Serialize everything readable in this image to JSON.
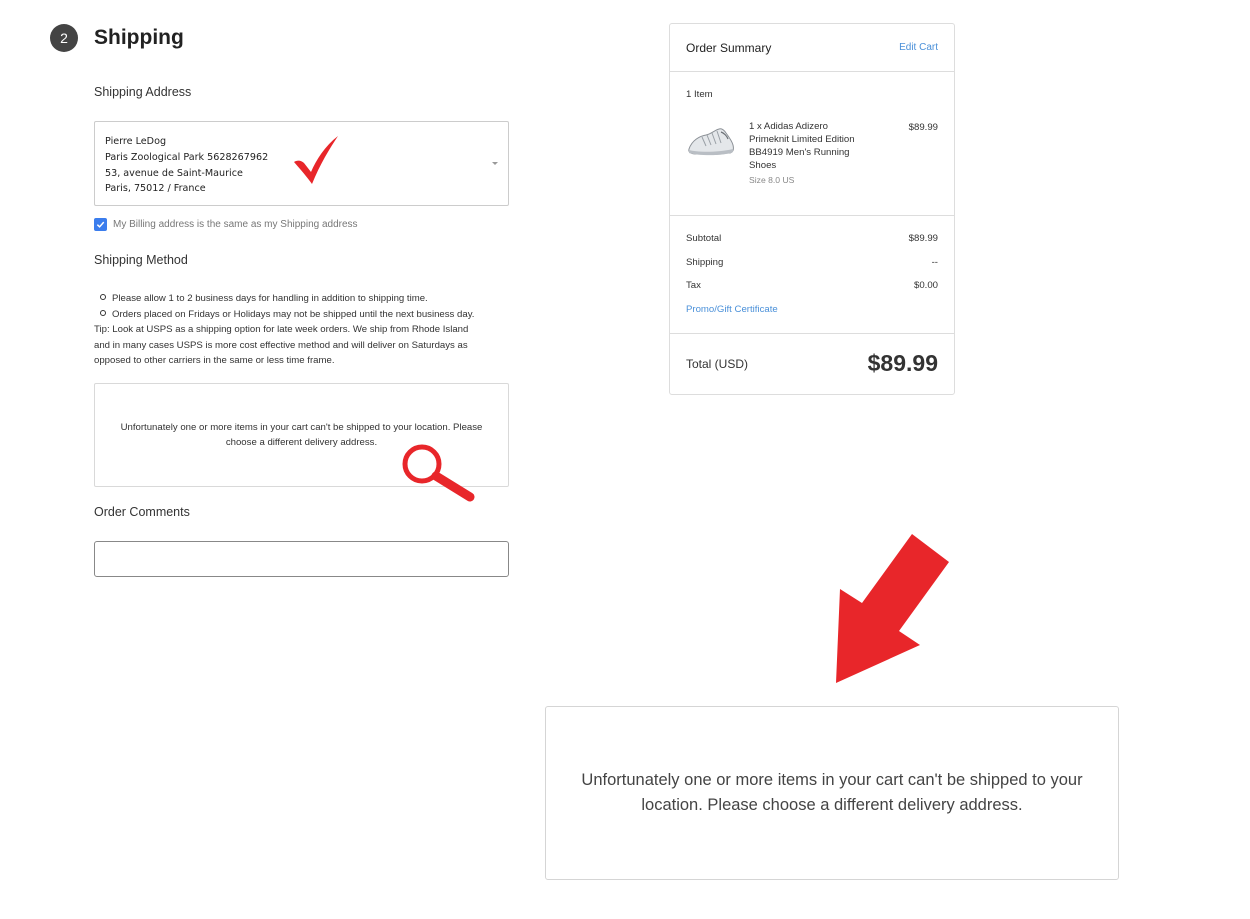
{
  "shipping": {
    "step_number": "2",
    "title": "Shipping",
    "address_label": "Shipping Address",
    "address_lines": [
      "Pierre LeDog",
      "Paris Zoological Park 5628267962",
      "53, avenue de Saint-Maurice",
      "Paris, 75012 / France"
    ],
    "billing_same_label": "My Billing address is the same as my Shipping address",
    "billing_same_checked": true,
    "method_label": "Shipping Method",
    "method_notes": [
      "Please allow 1 to 2 business days for handling in addition to shipping time.",
      "Orders placed on Fridays or Holidays may not be shipped until the next business day."
    ],
    "method_tip_lines": [
      "Tip: Look at USPS as a shipping option for late week orders. We ship from Rhode Island",
      "and in many cases USPS is more cost effective method and will deliver on Saturdays as",
      "opposed to other carriers in the same or less time frame."
    ],
    "error_lines": [
      "Unfortunately one or more items in your cart can't be shipped to your location. Please",
      "choose a different delivery address."
    ],
    "comments_label": "Order Comments",
    "comments_value": ""
  },
  "order_summary": {
    "title": "Order Summary",
    "edit_cart_label": "Edit Cart",
    "item_count": "1 Item",
    "item": {
      "name_lines": [
        "1 x Adidas Adizero",
        "Primeknit Limited Edition",
        "BB4919 Men's Running",
        "Shoes"
      ],
      "size": "Size 8.0 US",
      "price": "$89.99",
      "image_icon": "shoe-icon"
    },
    "rows": [
      {
        "label": "Subtotal",
        "value": "$89.99"
      },
      {
        "label": "Shipping",
        "value": "--"
      },
      {
        "label": "Tax",
        "value": "$0.00"
      }
    ],
    "promo_label": "Promo/Gift Certificate",
    "total_label": "Total (USD)",
    "total_value": "$89.99"
  },
  "callout": {
    "lines": [
      "Unfortunately one or more items in your cart can't be shipped to your",
      "location. Please choose a different delivery address."
    ]
  },
  "annotations": {
    "checkmark_icon": "checkmark-icon",
    "magnifier_icon": "magnifier-icon",
    "arrow_icon": "arrow-down-left-icon",
    "annotation_color": "#e8262a"
  },
  "colors": {
    "link": "#4a90d9",
    "checkbox": "#3b7ded",
    "step_badge": "#444444"
  }
}
